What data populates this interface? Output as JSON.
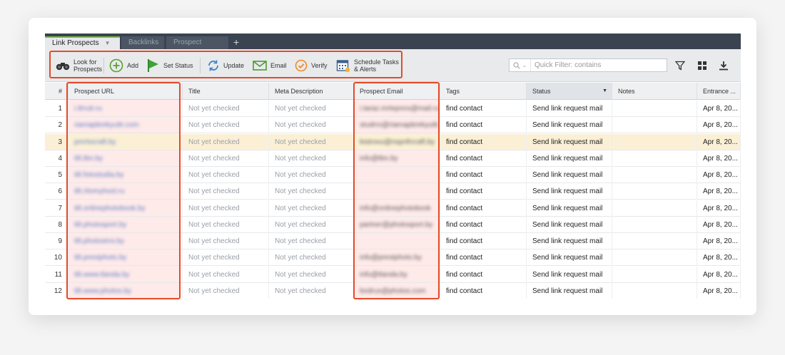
{
  "tabs": [
    {
      "label": "Link Prospects",
      "active": true
    },
    {
      "label": "Backlinks",
      "active": false
    },
    {
      "label": "Prospect quality",
      "active": false
    }
  ],
  "add_tab_symbol": "+",
  "toolbar": {
    "look_for_line1": "Look for",
    "look_for_line2": "Prospects",
    "add": "Add",
    "set_status": "Set Status",
    "update": "Update",
    "email": "Email",
    "verify": "Verify",
    "schedule_line1": "Schedule Tasks",
    "schedule_line2": "& Alerts"
  },
  "quick_filter": {
    "placeholder": "Quick Filter: contains",
    "value": ""
  },
  "accent_colors": {
    "highlight_border": "#e44b27",
    "active_tab": "#7cba3f",
    "row_highlight": "#fbf0d6"
  },
  "columns": [
    "#",
    "Prospect URL",
    "Title",
    "Meta Description",
    "Prospect Email",
    "Tags",
    "Status",
    "Notes",
    "Entrance ..."
  ],
  "sorted_column": "Status",
  "highlighted_row": 3,
  "rows": [
    {
      "num": "1",
      "url": "i.tlrrulr.ru",
      "title": "Not yet checked",
      "meta": "Not yet checked",
      "email": "i.taraz.mrtepnns@mail.ru",
      "tags": "find contact",
      "status": "Send link request mail",
      "notes": "",
      "entrance": "Apr 8, 20..."
    },
    {
      "num": "2",
      "url": "riamapbrekyuttr.com",
      "title": "Not yet checked",
      "meta": "Not yet checked",
      "email": "studrro@riamapbrekyutb",
      "tags": "find contact",
      "status": "Send link request mail",
      "notes": "",
      "entrance": "Apr 8, 20..."
    },
    {
      "num": "3",
      "url": "pmrtocraft.by",
      "title": "Not yet checked",
      "meta": "Not yet checked",
      "email": "kistrovu@nspnfrcraft.by",
      "tags": "find contact",
      "status": "Send link request mail",
      "notes": "",
      "entrance": "Apr 8, 20..."
    },
    {
      "num": "4",
      "url": "tilt.tbn.by",
      "title": "Not yet checked",
      "meta": "Not yet checked",
      "email": "info@tbn.by",
      "tags": "find contact",
      "status": "Send link request mail",
      "notes": "",
      "entrance": "Apr 8, 20..."
    },
    {
      "num": "5",
      "url": "tilt.fotostudia.by",
      "title": "Not yet checked",
      "meta": "Not yet checked",
      "email": "",
      "tags": "find contact",
      "status": "Send link request mail",
      "notes": "",
      "entrance": "Apr 8, 20..."
    },
    {
      "num": "6",
      "url": "tilt.ritomyhost.ru",
      "title": "Not yet checked",
      "meta": "Not yet checked",
      "email": "",
      "tags": "find contact",
      "status": "Send link request mail",
      "notes": "",
      "entrance": "Apr 8, 20..."
    },
    {
      "num": "7",
      "url": "tilt.onlinephotobook.by",
      "title": "Not yet checked",
      "meta": "Not yet checked",
      "email": "info@onlinephotobook",
      "tags": "find contact",
      "status": "Send link request mail",
      "notes": "",
      "entrance": "Apr 8, 20..."
    },
    {
      "num": "8",
      "url": "tilt.photosport.by",
      "title": "Not yet checked",
      "meta": "Not yet checked",
      "email": "partner@photosport.by",
      "tags": "find contact",
      "status": "Send link request mail",
      "notes": "",
      "entrance": "Apr 8, 20..."
    },
    {
      "num": "9",
      "url": "tilt.photostroi.by",
      "title": "Not yet checked",
      "meta": "Not yet checked",
      "email": "",
      "tags": "find contact",
      "status": "Send link request mail",
      "notes": "",
      "entrance": "Apr 8, 20..."
    },
    {
      "num": "10",
      "url": "tilt.prestphoto.by",
      "title": "Not yet checked",
      "meta": "Not yet checked",
      "email": "info@prestphoto.by",
      "tags": "find contact",
      "status": "Send link request mail",
      "notes": "",
      "entrance": "Apr 8, 20..."
    },
    {
      "num": "11",
      "url": "tilt.www.tlanda.by",
      "title": "Not yet checked",
      "meta": "Not yet checked",
      "email": "info@tlanda.by",
      "tags": "find contact",
      "status": "Send link request mail",
      "notes": "",
      "entrance": "Apr 8, 20..."
    },
    {
      "num": "12",
      "url": "tilt.www.photos.by",
      "title": "Not yet checked",
      "meta": "Not yet checked",
      "email": "bodrus@photos.com",
      "tags": "find contact",
      "status": "Send link request mail",
      "notes": "",
      "entrance": "Apr 8, 20..."
    }
  ]
}
